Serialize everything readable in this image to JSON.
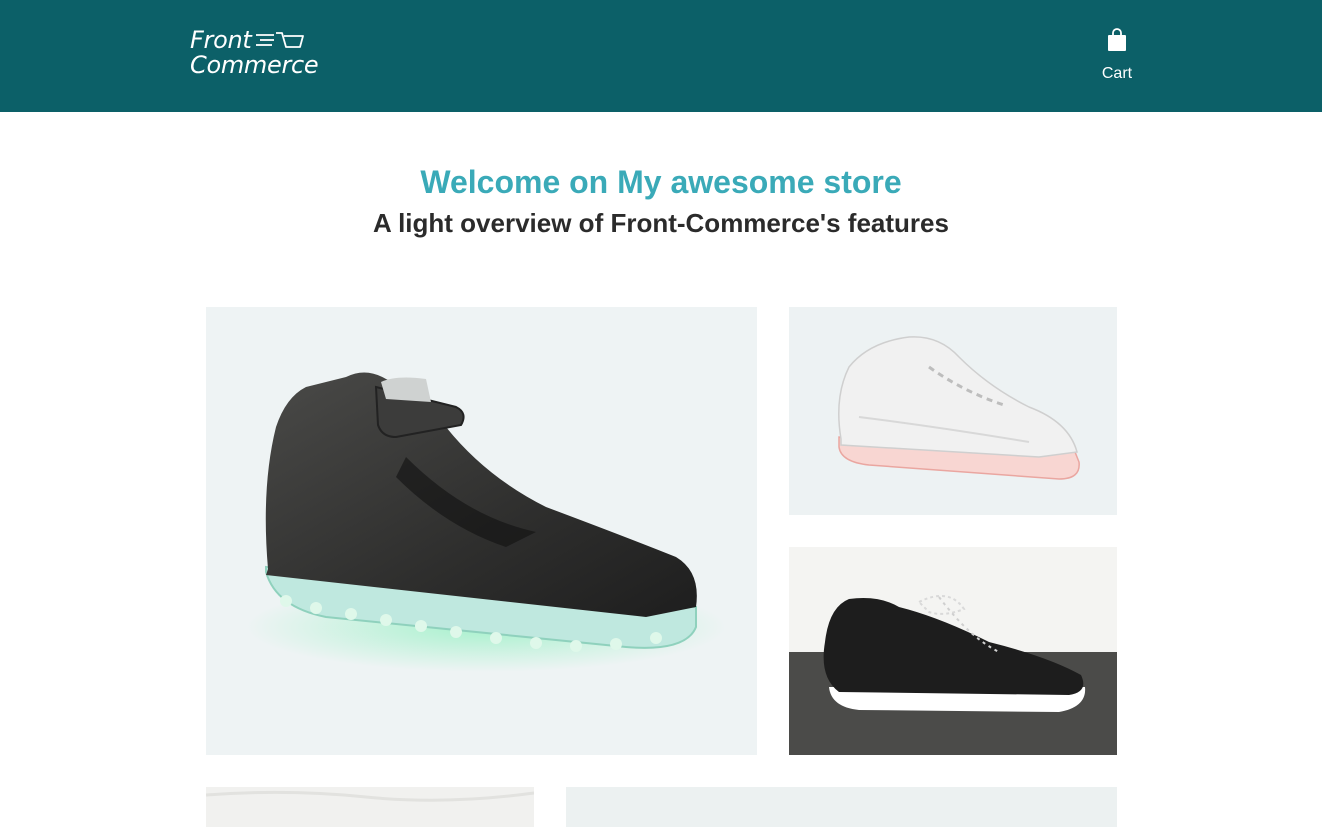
{
  "header": {
    "logo": {
      "line1": "Front",
      "line2": "Commerce",
      "icon": "cart-speed-icon"
    },
    "cart": {
      "label": "Cart",
      "icon": "shopping-bag-icon"
    },
    "background_color": "#0c6068"
  },
  "hero": {
    "title": "Welcome on My awesome store",
    "subtitle": "A light overview of Front-Commerce's features",
    "title_color": "#3aaab8"
  },
  "tiles": [
    {
      "name": "black-high-top-light-sneaker",
      "icon": "shoe-photo"
    },
    {
      "name": "white-light-sneaker",
      "icon": "shoe-photo"
    },
    {
      "name": "black-knit-sneaker",
      "icon": "shoe-photo"
    },
    {
      "name": "bottom-left-photo",
      "icon": "photo"
    },
    {
      "name": "bottom-right-photo",
      "icon": "photo"
    }
  ]
}
